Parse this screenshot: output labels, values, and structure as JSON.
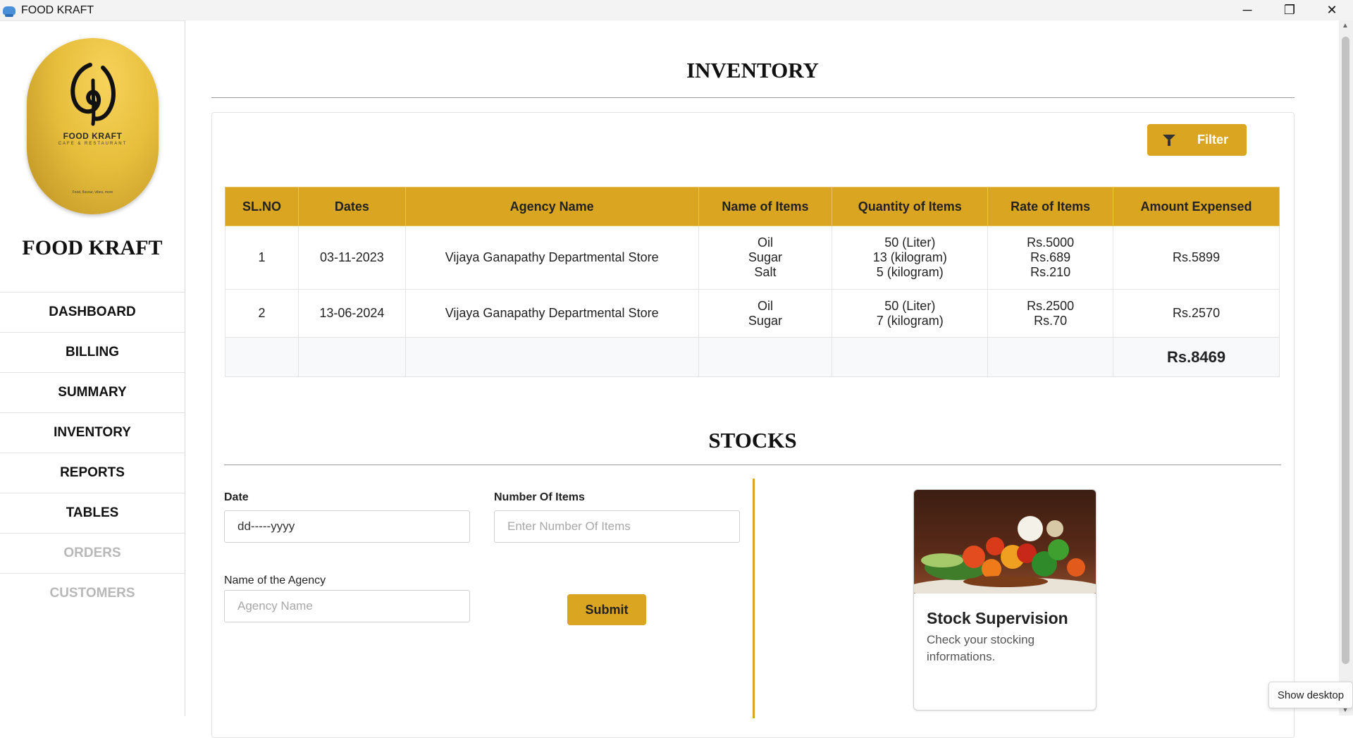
{
  "window": {
    "title": "FOOD KRAFT",
    "minimize": "─",
    "restore": "❐",
    "close": "✕"
  },
  "sidebar": {
    "logo": {
      "name": "FOOD KRAFT",
      "subtitle": "CAFE & RESTAURANT",
      "tiny": "Food, flavour, vibes, more"
    },
    "brand": "FOOD KRAFT",
    "items": [
      {
        "label": "DASHBOARD",
        "enabled": true
      },
      {
        "label": "BILLING",
        "enabled": true
      },
      {
        "label": "SUMMARY",
        "enabled": true
      },
      {
        "label": "INVENTORY",
        "enabled": true
      },
      {
        "label": "REPORTS",
        "enabled": true
      },
      {
        "label": "TABLES",
        "enabled": true
      },
      {
        "label": "ORDERS",
        "enabled": false
      },
      {
        "label": "CUSTOMERS",
        "enabled": false
      }
    ]
  },
  "inventory": {
    "title": "INVENTORY",
    "filter_label": "Filter",
    "columns": [
      "SL.NO",
      "Dates",
      "Agency Name",
      "Name of Items",
      "Quantity of Items",
      "Rate of Items",
      "Amount Expensed"
    ],
    "rows": [
      {
        "sl": "1",
        "date": "03-11-2023",
        "agency": "Vijaya Ganapathy Departmental Store",
        "items": [
          "Oil",
          "Sugar",
          "Salt"
        ],
        "quantities": [
          "50 (Liter)",
          "13 (kilogram)",
          "5 (kilogram)"
        ],
        "rates": [
          "Rs.5000",
          "Rs.689",
          "Rs.210"
        ],
        "amount": "Rs.5899"
      },
      {
        "sl": "2",
        "date": "13-06-2024",
        "agency": "Vijaya Ganapathy Departmental Store",
        "items": [
          "Oil",
          "Sugar"
        ],
        "quantities": [
          "50 (Liter)",
          "7 (kilogram)"
        ],
        "rates": [
          "Rs.2500",
          "Rs.70"
        ],
        "amount": "Rs.2570"
      }
    ],
    "total": "Rs.8469"
  },
  "stocks": {
    "title": "STOCKS",
    "date_label": "Date",
    "date_value": "dd-----yyyy",
    "number_label": "Number Of Items",
    "number_placeholder": "Enter Number Of Items",
    "agency_label": "Name of the Agency",
    "agency_placeholder": "Agency Name",
    "submit_label": "Submit"
  },
  "promo": {
    "title": "Stock Supervision",
    "text": "Check your stocking informations."
  },
  "tooltip": "Show desktop",
  "colors": {
    "accent": "#daa520",
    "disabled": "#b8b8b8"
  }
}
